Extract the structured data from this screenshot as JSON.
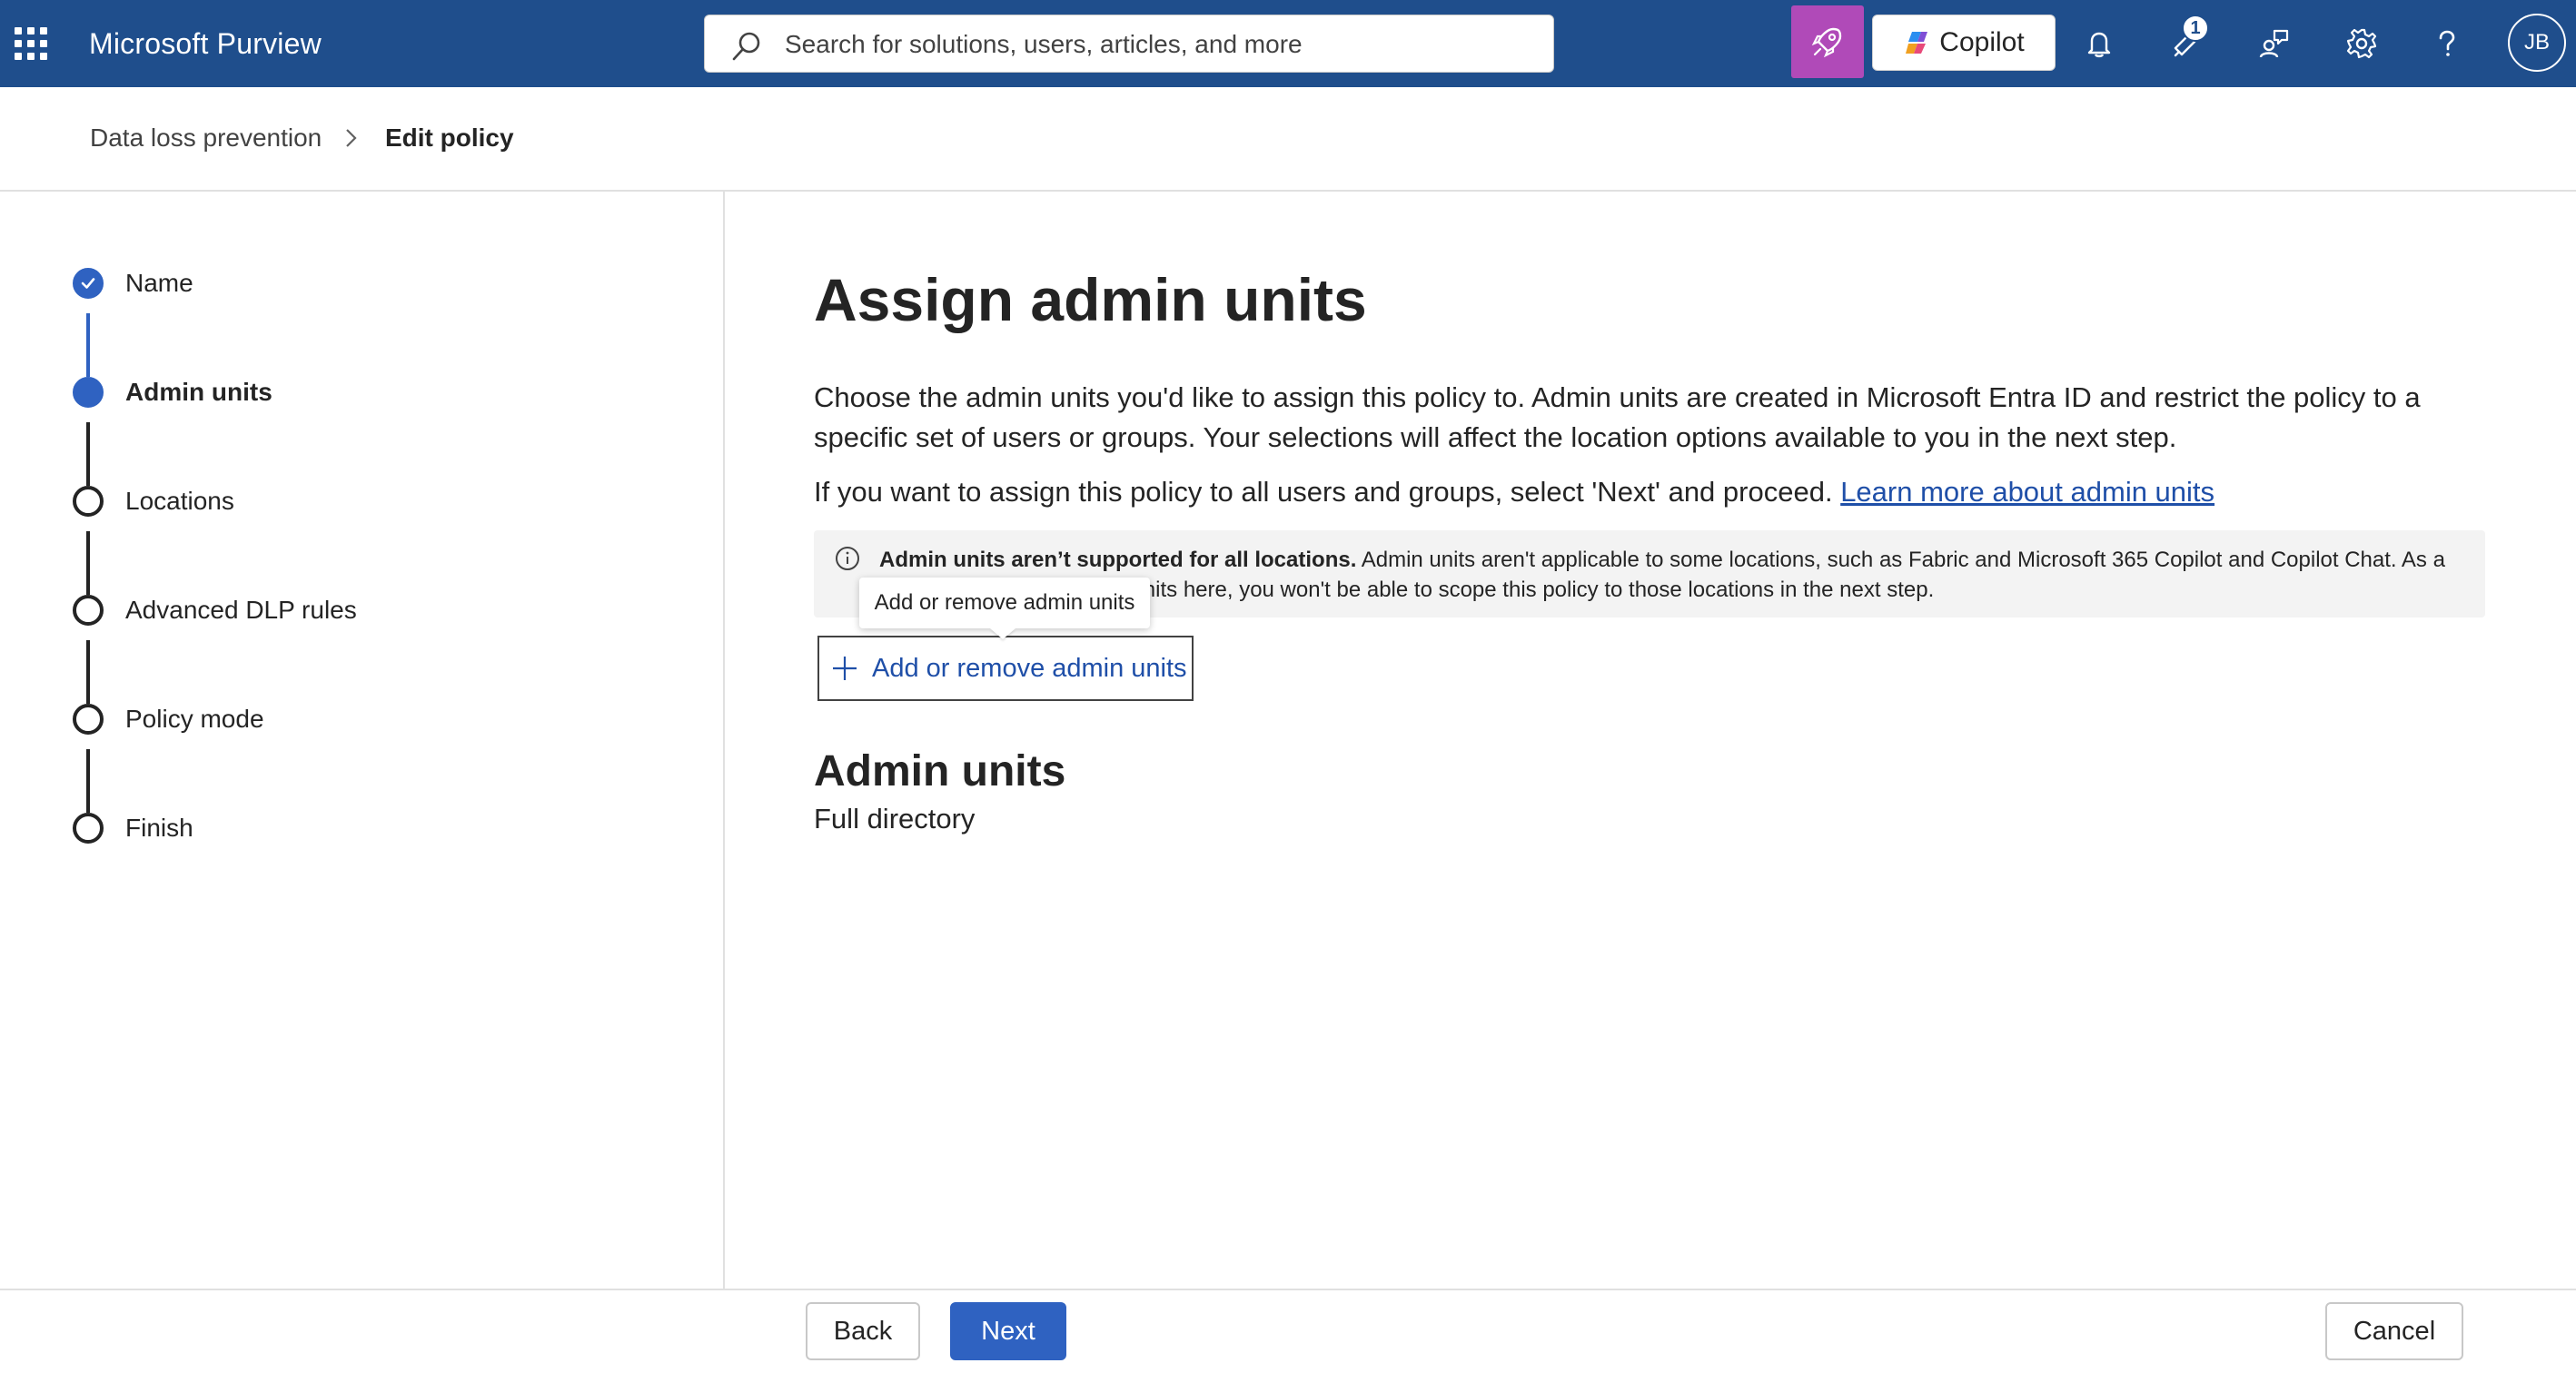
{
  "header": {
    "app_title": "Microsoft Purview",
    "search_placeholder": "Search for solutions, users, articles, and more",
    "copilot_label": "Copilot",
    "notification_count": "1",
    "user_initials": "JB"
  },
  "breadcrumb": {
    "parent": "Data loss prevention",
    "current": "Edit policy"
  },
  "steps": [
    {
      "label": "Name",
      "state": "done"
    },
    {
      "label": "Admin units",
      "state": "current"
    },
    {
      "label": "Locations",
      "state": "todo"
    },
    {
      "label": "Advanced DLP rules",
      "state": "todo"
    },
    {
      "label": "Policy mode",
      "state": "todo"
    },
    {
      "label": "Finish",
      "state": "todo"
    }
  ],
  "main": {
    "title": "Assign admin units",
    "description": "Choose the admin units you'd like to assign this policy to. Admin units are created in Microsoft Entra ID and restrict the policy to a specific set of users or groups. Your selections will affect the location options available to you in the next step.",
    "description2": "If you want to assign this policy to all users and groups, select 'Next' and proceed.",
    "learn_more_link": "Learn more about admin units",
    "info_bold": "Admin units aren’t supported for all locations.",
    "info_text": " Admin units aren't applicable to some locations, such as Fabric and Microsoft 365 Copilot and Copilot Chat. As a result, if you select admin units here, you won't be able to scope this policy to those locations in the next step.",
    "tooltip": "Add or remove admin units",
    "add_button_label": "Add or remove admin units",
    "section_title": "Admin units",
    "section_value": "Full directory"
  },
  "footer": {
    "back_label": "Back",
    "next_label": "Next",
    "cancel_label": "Cancel"
  },
  "colors": {
    "header_bg": "#1f4e8c",
    "accent": "#2f62c1",
    "link": "#1f4fa8",
    "copilot_rocket_bg": "#b04ab8"
  }
}
